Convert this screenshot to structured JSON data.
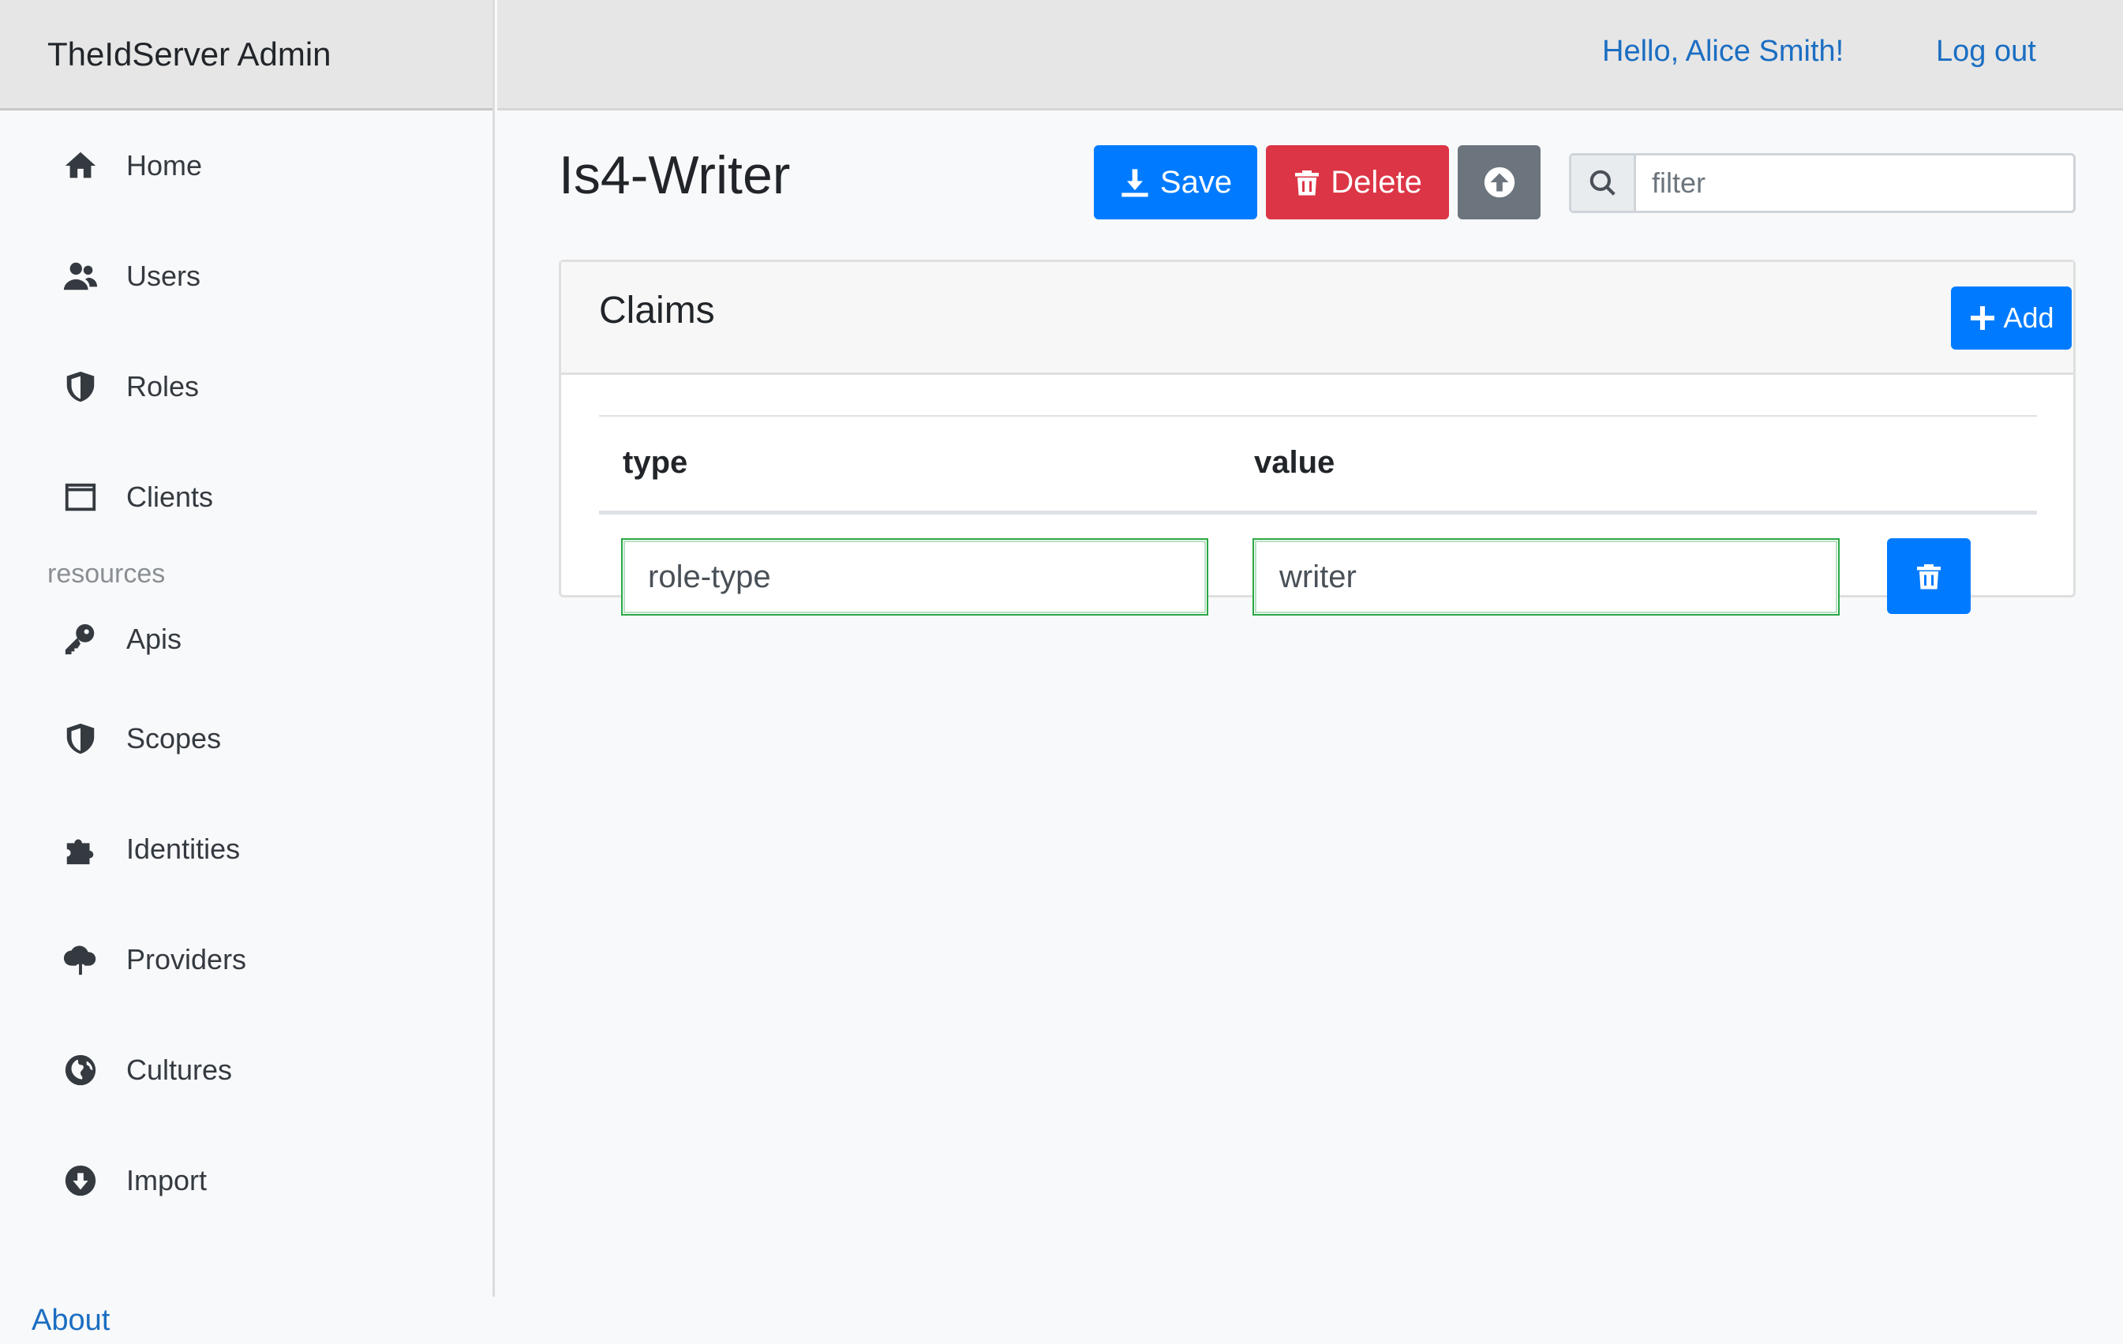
{
  "app": {
    "brand": "TheIdServer Admin"
  },
  "header": {
    "greeting": "Hello, Alice Smith!",
    "logout": "Log out"
  },
  "sidebar": {
    "items": [
      {
        "label": "Home",
        "icon": "home-icon"
      },
      {
        "label": "Users",
        "icon": "users-icon"
      },
      {
        "label": "Roles",
        "icon": "shield-icon"
      },
      {
        "label": "Clients",
        "icon": "window-icon"
      }
    ],
    "resources_heading": "resources",
    "resource_items": [
      {
        "label": "Apis",
        "icon": "key-icon"
      },
      {
        "label": "Scopes",
        "icon": "shield-icon"
      },
      {
        "label": "Identities",
        "icon": "puzzle-icon"
      },
      {
        "label": "Providers",
        "icon": "cloud-upload-icon"
      },
      {
        "label": "Cultures",
        "icon": "globe-icon"
      },
      {
        "label": "Import",
        "icon": "arrow-down-circle-icon"
      }
    ],
    "about": "About"
  },
  "page": {
    "title": "Is4-Writer",
    "save_label": "Save",
    "delete_label": "Delete",
    "filter_placeholder": "filter"
  },
  "claims": {
    "title": "Claims",
    "add_label": "Add",
    "columns": [
      "type",
      "value"
    ],
    "rows": [
      {
        "type": "role-type",
        "value": "writer"
      }
    ]
  },
  "colors": {
    "primary": "#007bff",
    "danger": "#dc3545",
    "secondary": "#6c757d",
    "link": "#1b6ec2",
    "valid": "#28a745"
  }
}
